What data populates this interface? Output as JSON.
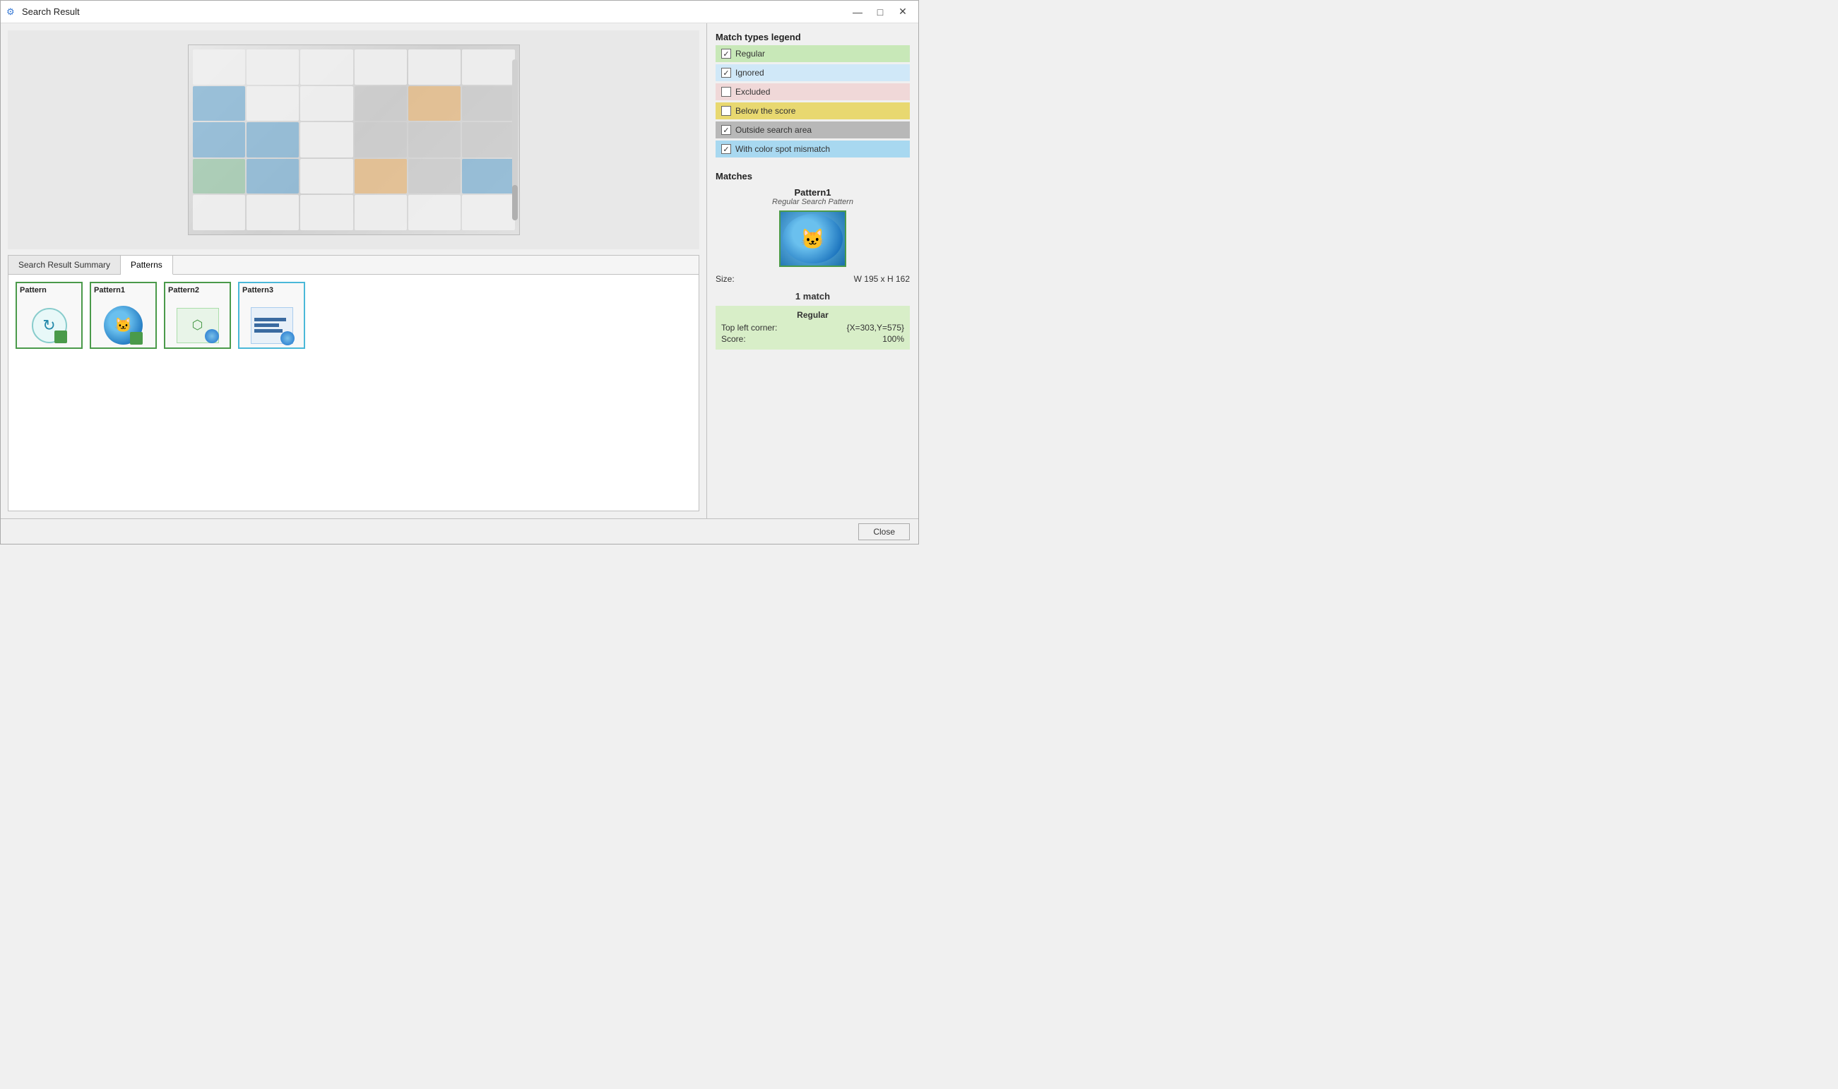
{
  "window": {
    "title": "Search Result",
    "icon": "⚙"
  },
  "title_bar": {
    "minimize": "—",
    "maximize": "□",
    "close": "✕"
  },
  "tabs": [
    {
      "label": "Search Result Summary",
      "active": false
    },
    {
      "label": "Patterns",
      "active": true
    }
  ],
  "legend": {
    "title": "Match types legend",
    "items": [
      {
        "label": "Regular",
        "color": "green",
        "checked": true
      },
      {
        "label": "Ignored",
        "color": "blue-light",
        "checked": true
      },
      {
        "label": "Excluded",
        "color": "pink",
        "checked": false
      },
      {
        "label": "Below the score",
        "color": "yellow",
        "checked": false
      },
      {
        "label": "Outside search area",
        "color": "gray",
        "checked": true
      },
      {
        "label": "With color spot mismatch",
        "color": "cyan",
        "checked": true
      }
    ]
  },
  "matches": {
    "title": "Matches",
    "pattern_name": "Pattern1",
    "pattern_type": "Regular Search Pattern",
    "size_label": "Size:",
    "size_value": "W 195 x H 162",
    "match_count": "1 match",
    "details": {
      "type": "Regular",
      "top_left_label": "Top left corner:",
      "top_left_value": "{X=303,Y=575}",
      "score_label": "Score:",
      "score_value": "100%"
    }
  },
  "patterns": [
    {
      "label": "Pattern",
      "border": "green-border"
    },
    {
      "label": "Pattern1",
      "border": "green-border"
    },
    {
      "label": "Pattern2",
      "border": "green-border"
    },
    {
      "label": "Pattern3",
      "border": "cyan-border"
    }
  ],
  "footer": {
    "close_label": "Close"
  }
}
